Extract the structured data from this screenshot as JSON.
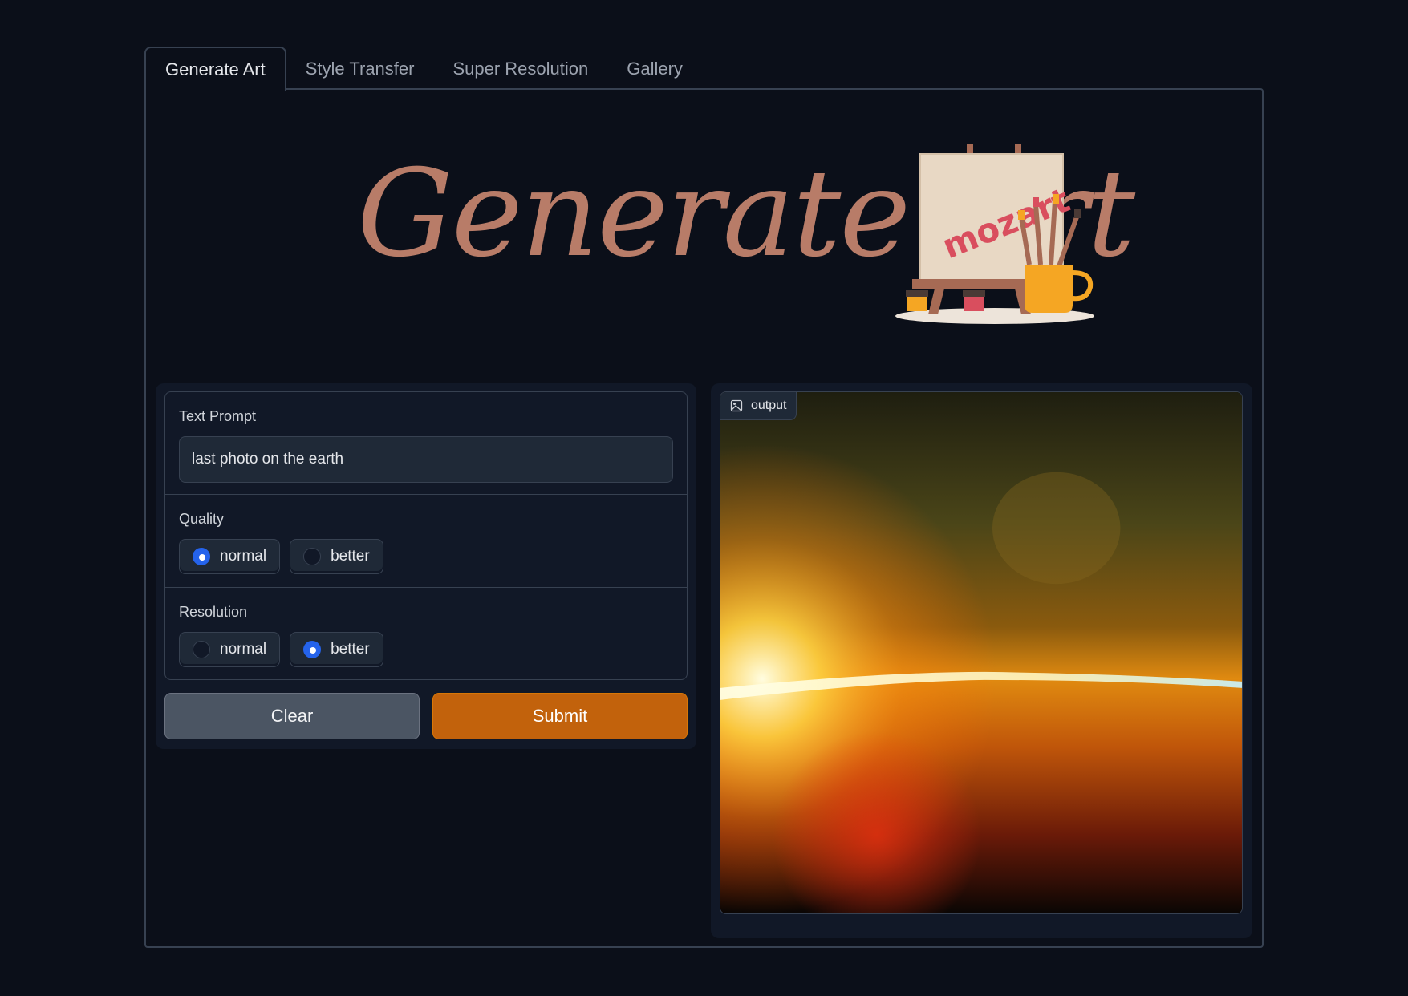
{
  "tabs": [
    {
      "label": "Generate Art",
      "active": true
    },
    {
      "label": "Style Transfer",
      "active": false
    },
    {
      "label": "Super Resolution",
      "active": false
    },
    {
      "label": "Gallery",
      "active": false
    }
  ],
  "banner": {
    "title": "Generate Art",
    "canvas_text": "mozart"
  },
  "form": {
    "text_prompt": {
      "label": "Text Prompt",
      "value": "last photo on the earth"
    },
    "quality": {
      "label": "Quality",
      "options": [
        "normal",
        "better"
      ],
      "selected": "normal"
    },
    "resolution": {
      "label": "Resolution",
      "options": [
        "normal",
        "better"
      ],
      "selected": "better"
    }
  },
  "buttons": {
    "clear": "Clear",
    "submit": "Submit"
  },
  "output": {
    "label": "output",
    "icon": "image-icon"
  },
  "colors": {
    "accent": "#c2620c",
    "radio_selected": "#2563eb",
    "background": "#0b0f19",
    "banner_text": "#b87c68"
  }
}
